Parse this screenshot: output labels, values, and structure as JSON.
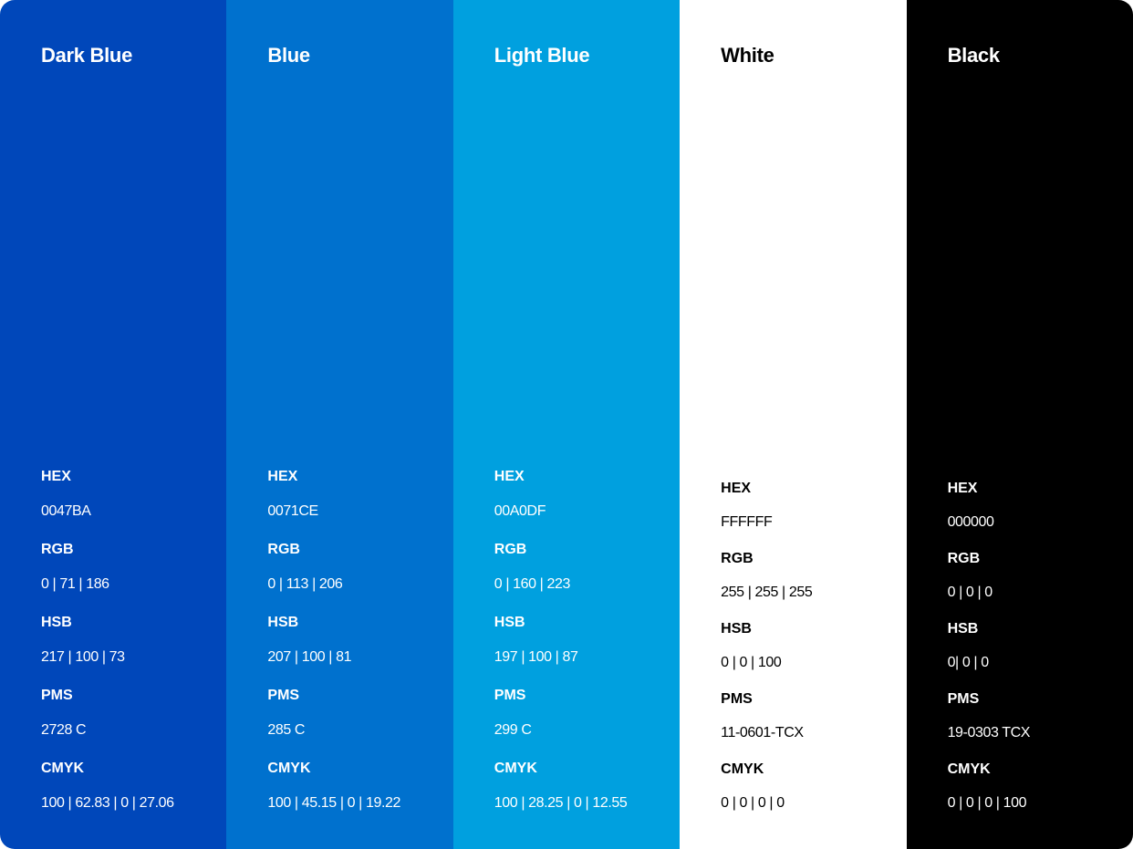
{
  "swatches": [
    {
      "name": "Dark Blue",
      "bg": "#0047BA",
      "fg": "#FFFFFF",
      "specs": [
        {
          "label": "HEX",
          "value": "0047BA"
        },
        {
          "label": "RGB",
          "value": "0 | 71 | 186"
        },
        {
          "label": "HSB",
          "value": "217 | 100 | 73"
        },
        {
          "label": "PMS",
          "value": "2728 C"
        },
        {
          "label": "CMYK",
          "value": "100 | 62.83 | 0 | 27.06"
        }
      ]
    },
    {
      "name": "Blue",
      "bg": "#0071CE",
      "fg": "#FFFFFF",
      "specs": [
        {
          "label": "HEX",
          "value": "0071CE"
        },
        {
          "label": "RGB",
          "value": "0 | 113 | 206"
        },
        {
          "label": "HSB",
          "value": "207 | 100 | 81"
        },
        {
          "label": "PMS",
          "value": "285 C"
        },
        {
          "label": "CMYK",
          "value": "100 | 45.15 | 0 | 19.22"
        }
      ]
    },
    {
      "name": "Light Blue",
      "bg": "#00A0DF",
      "fg": "#FFFFFF",
      "specs": [
        {
          "label": "HEX",
          "value": "00A0DF"
        },
        {
          "label": "RGB",
          "value": "0 | 160 | 223"
        },
        {
          "label": "HSB",
          "value": "197 | 100 | 87"
        },
        {
          "label": "PMS",
          "value": "299 C"
        },
        {
          "label": "CMYK",
          "value": "100 | 28.25 | 0 | 12.55"
        }
      ]
    },
    {
      "name": "White",
      "bg": "#FFFFFF",
      "fg": "#000000",
      "specs": [
        {
          "label": "HEX",
          "value": "FFFFFF"
        },
        {
          "label": "RGB",
          "value": "255 | 255 | 255"
        },
        {
          "label": "HSB",
          "value": "0 | 0 | 100"
        },
        {
          "label": "PMS",
          "value": "11-0601-TCX"
        },
        {
          "label": "CMYK",
          "value": "0 | 0 | 0 | 0"
        }
      ]
    },
    {
      "name": "Black",
      "bg": "#000000",
      "fg": "#FFFFFF",
      "specs": [
        {
          "label": "HEX",
          "value": "000000"
        },
        {
          "label": "RGB",
          "value": "0 | 0 | 0"
        },
        {
          "label": "HSB",
          "value": "0| 0 | 0"
        },
        {
          "label": "PMS",
          "value": "19-0303 TCX"
        },
        {
          "label": "CMYK",
          "value": "0 | 0 | 0 | 100"
        }
      ]
    }
  ]
}
